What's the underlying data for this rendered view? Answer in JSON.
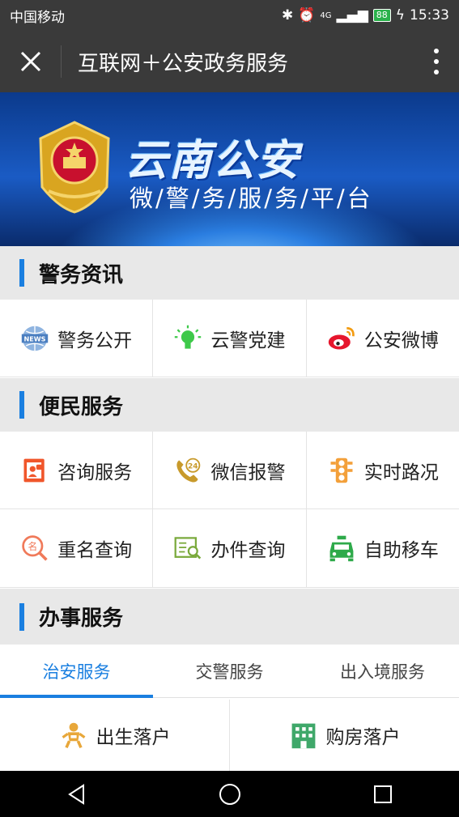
{
  "status": {
    "carrier": "中国移动",
    "network": "4G",
    "battery": "88",
    "time": "15:33"
  },
  "header": {
    "title": "互联网＋公安政务服务"
  },
  "banner": {
    "title": "云南公安",
    "subtitle": "微/警/务/服/务/平/台"
  },
  "sections": {
    "news": {
      "label": "警务资讯"
    },
    "service": {
      "label": "便民服务"
    },
    "affairs": {
      "label": "办事服务"
    }
  },
  "news_items": [
    {
      "label": "警务公开",
      "icon": "news-icon",
      "badge": "NEWS"
    },
    {
      "label": "云警党建",
      "icon": "lightbulb-icon"
    },
    {
      "label": "公安微博",
      "icon": "weibo-icon"
    }
  ],
  "service_items": [
    {
      "label": "咨询服务",
      "icon": "consult-icon"
    },
    {
      "label": "微信报警",
      "icon": "phone-24-icon",
      "badge": "24"
    },
    {
      "label": "实时路况",
      "icon": "traffic-light-icon"
    },
    {
      "label": "重名查询",
      "icon": "name-search-icon",
      "badge": "名"
    },
    {
      "label": "办件查询",
      "icon": "document-search-icon"
    },
    {
      "label": "自助移车",
      "icon": "car-icon"
    }
  ],
  "tabs": [
    "治安服务",
    "交警服务",
    "出入境服务"
  ],
  "affairs_items": [
    {
      "label": "出生落户",
      "icon": "baby-icon"
    },
    {
      "label": "购房落户",
      "icon": "building-icon"
    }
  ],
  "colors": {
    "accent": "#1a7fe0",
    "dark": "#3a3a3a"
  }
}
